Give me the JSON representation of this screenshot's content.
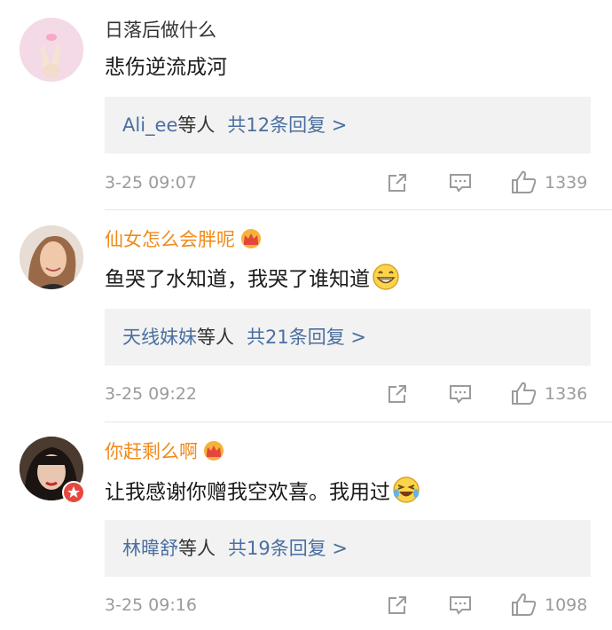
{
  "comments": [
    {
      "author": "日落后做什么",
      "text": "悲伤逆流成河",
      "reply_names": "Ali_ee",
      "reply_deng": "等人",
      "reply_count": "共12条回复 >",
      "time": "3-25 09:07",
      "likes": "1339"
    },
    {
      "author": "仙女怎么会胖呢",
      "text": "鱼哭了水知道，我哭了谁知道",
      "reply_names": "天线妹妹",
      "reply_deng": "等人",
      "reply_count": "共21条回复 >",
      "time": "3-25 09:22",
      "likes": "1336"
    },
    {
      "author": "你赶剩么啊",
      "text": "让我感谢你赠我空欢喜。我用过",
      "reply_names": "林暐舒",
      "reply_deng": "等人",
      "reply_count": "共19条回复 >",
      "time": "3-25 09:16",
      "likes": "1098"
    }
  ],
  "icons": {
    "share": "share-icon",
    "comment": "comment-icon",
    "like": "like-icon",
    "crown": "crown-icon",
    "emoji_grin": "grin-emoji",
    "emoji_laugh": "laugh-cry-emoji"
  },
  "colors": {
    "vip_name": "#f08a1a",
    "link": "#4a6fa0",
    "meta": "#9b9b9b",
    "reply_bg": "#f2f2f2"
  }
}
